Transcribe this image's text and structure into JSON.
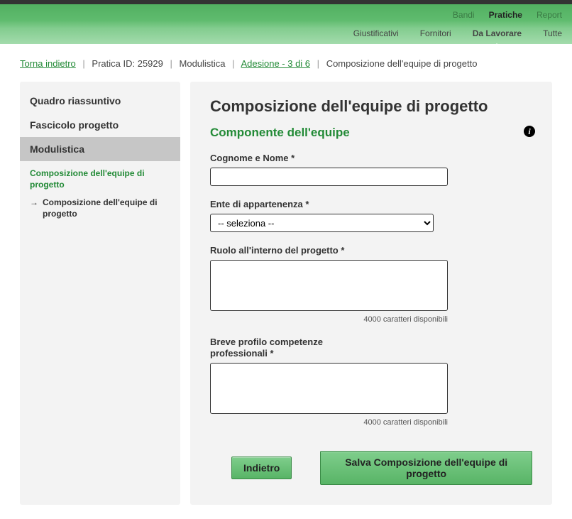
{
  "tabs_top": {
    "bandi": "Bandi",
    "pratiche": "Pratiche",
    "report": "Report"
  },
  "tabs_bottom": {
    "giustificativi": "Giustificativi",
    "fornitori": "Fornitori",
    "da_lavorare": "Da Lavorare",
    "tutte": "Tutte"
  },
  "breadcrumb": {
    "back": "Torna indietro",
    "pratica_id": "Pratica ID: 25929",
    "modulistica": "Modulistica",
    "adesione": "Adesione - 3 di 6",
    "current": "Composizione dell'equipe di progetto"
  },
  "sidebar": {
    "quadro": "Quadro riassuntivo",
    "fascicolo": "Fascicolo progetto",
    "modulistica": "Modulistica",
    "sub_link": "Composizione dell'equipe di progetto",
    "sub_current": "Composizione dell'equipe di progetto"
  },
  "form": {
    "title": "Composizione dell'equipe di progetto",
    "subtitle": "Componente dell'equipe",
    "cognome_label": "Cognome e Nome *",
    "cognome_value": "",
    "ente_label": "Ente di appartenenza *",
    "ente_placeholder": "-- seleziona --",
    "ruolo_label": "Ruolo all'interno del progetto *",
    "ruolo_value": "",
    "ruolo_count": "4000",
    "ruolo_count_text": " caratteri disponibili",
    "profilo_label": "Breve profilo competenze professionali *",
    "profilo_value": "",
    "profilo_count": "4000",
    "profilo_count_text": " caratteri disponibili"
  },
  "buttons": {
    "indietro": "Indietro",
    "salva": "Salva Composizione dell'equipe di progetto"
  }
}
